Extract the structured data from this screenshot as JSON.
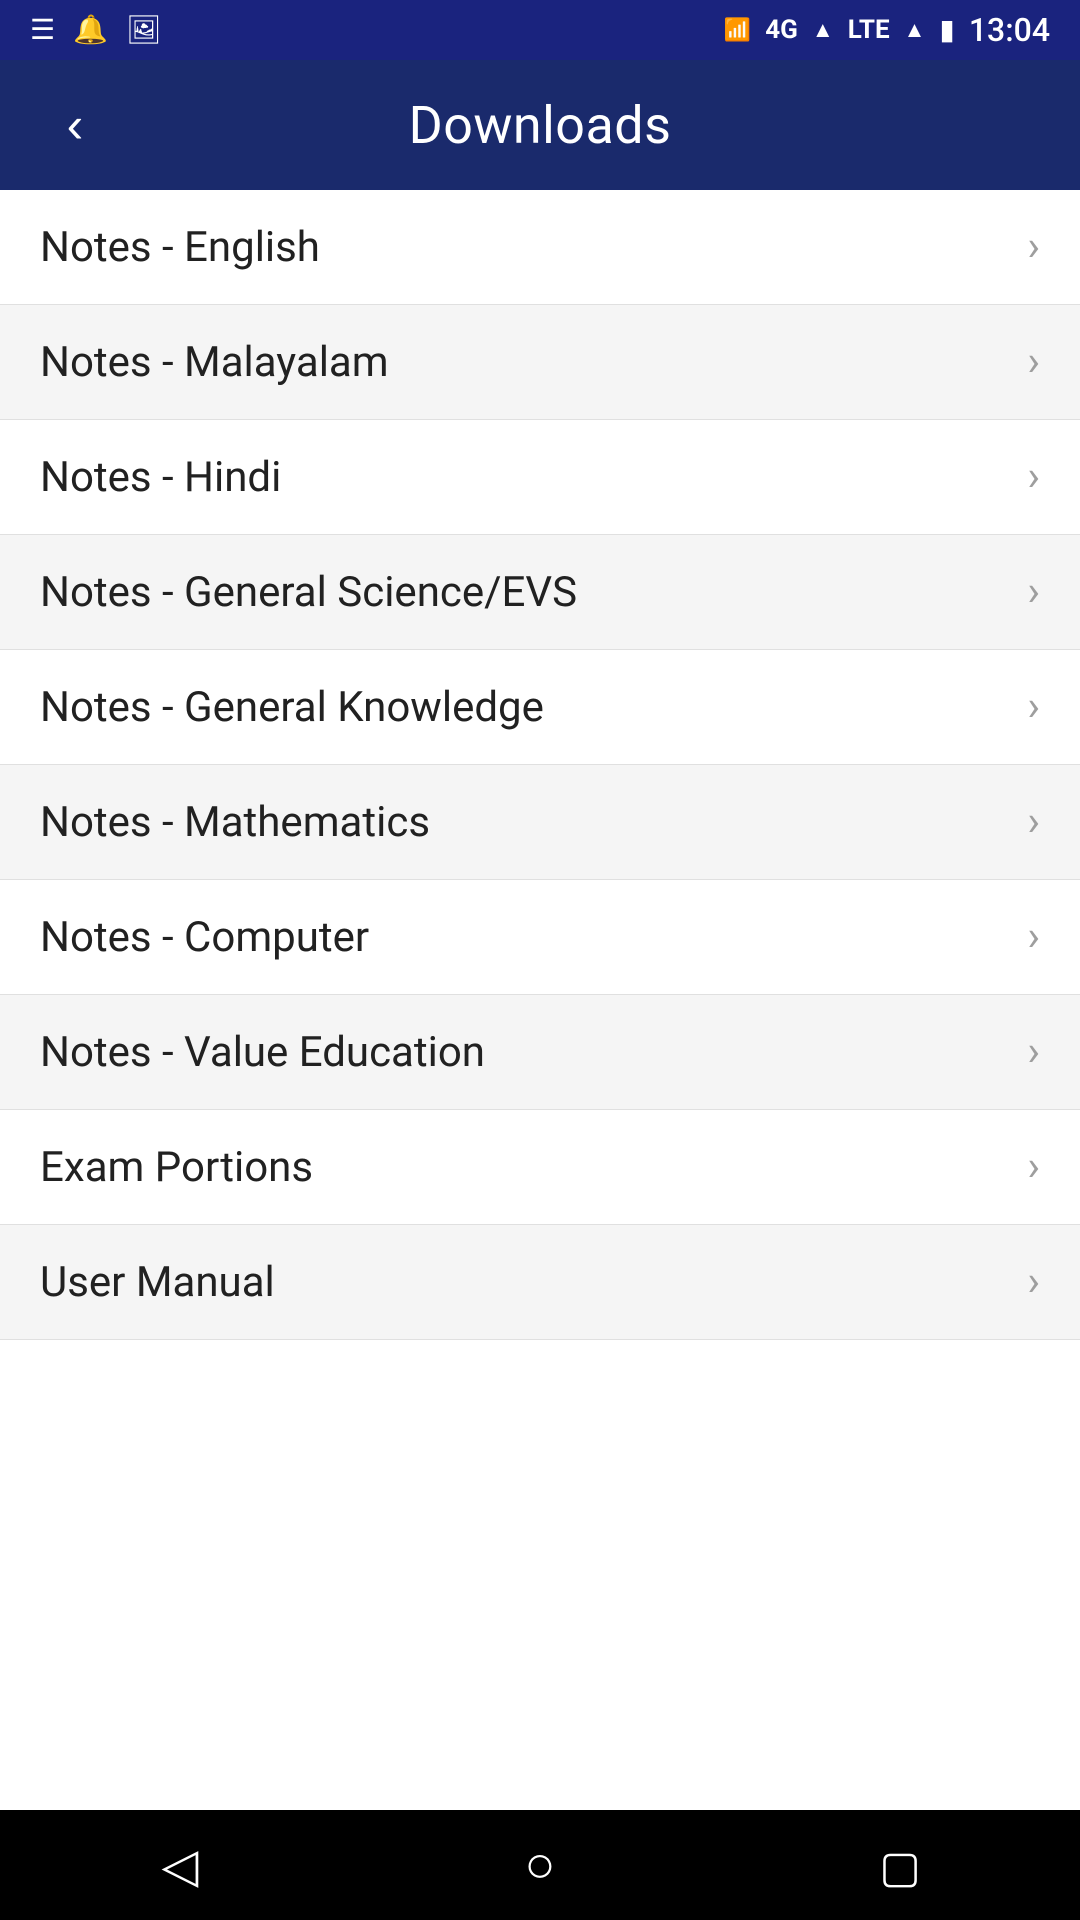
{
  "statusBar": {
    "time": "13:04",
    "icons": {
      "list": "☰",
      "notification": "🔔",
      "image": "🖼",
      "signal4g": "4G",
      "lte": "LTE",
      "battery": "🔋"
    }
  },
  "appBar": {
    "title": "Downloads",
    "backLabel": "‹"
  },
  "listItems": [
    {
      "id": 1,
      "label": "Notes - English"
    },
    {
      "id": 2,
      "label": "Notes - Malayalam"
    },
    {
      "id": 3,
      "label": "Notes - Hindi"
    },
    {
      "id": 4,
      "label": "Notes - General Science/EVS"
    },
    {
      "id": 5,
      "label": "Notes - General Knowledge"
    },
    {
      "id": 6,
      "label": "Notes - Mathematics"
    },
    {
      "id": 7,
      "label": "Notes - Computer"
    },
    {
      "id": 8,
      "label": "Notes - Value Education"
    },
    {
      "id": 9,
      "label": "Exam Portions"
    },
    {
      "id": 10,
      "label": "User Manual"
    }
  ],
  "navBar": {
    "backLabel": "◁",
    "homeLabel": "○",
    "recentLabel": "▢"
  }
}
